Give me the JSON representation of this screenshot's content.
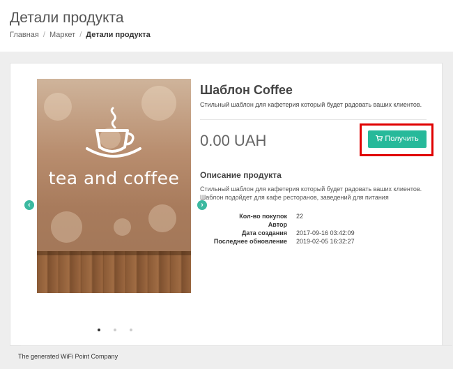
{
  "header": {
    "title": "Детали продукта",
    "breadcrumb": [
      {
        "label": "Главная"
      },
      {
        "label": "Маркет"
      },
      {
        "label": "Детали продукта"
      }
    ]
  },
  "product": {
    "title": "Шаблон Coffee",
    "subtitle": "Стильный шаблон для кафетерия который будет радовать ваших клиентов.",
    "price": "0.00 UAH",
    "get_button": "Получить",
    "image_text": "tea and coffee",
    "description_title": "Описание продукта",
    "description": "Стильный шаблон для кафетерия который будет радовать ваших клиентов. Шаблон подойдет для кафе ресторанов, заведений для питания",
    "stats": [
      {
        "label": "Кол-во покупок",
        "value": "22"
      },
      {
        "label": "Автор",
        "value": ""
      },
      {
        "label": "Дата создания",
        "value": "2017-09-16 03:42:09"
      },
      {
        "label": "Последнее обновление",
        "value": "2019-02-05 16:32:27"
      }
    ]
  },
  "carousel": {
    "active_index": 0,
    "dot_count": 3
  },
  "footer": {
    "text": "The generated WiFi Point Company"
  },
  "colors": {
    "accent": "#26b99a",
    "highlight": "#e00000"
  },
  "icons": {
    "prev": "chevron-left-icon",
    "next": "chevron-right-icon",
    "cart": "cart-icon"
  }
}
